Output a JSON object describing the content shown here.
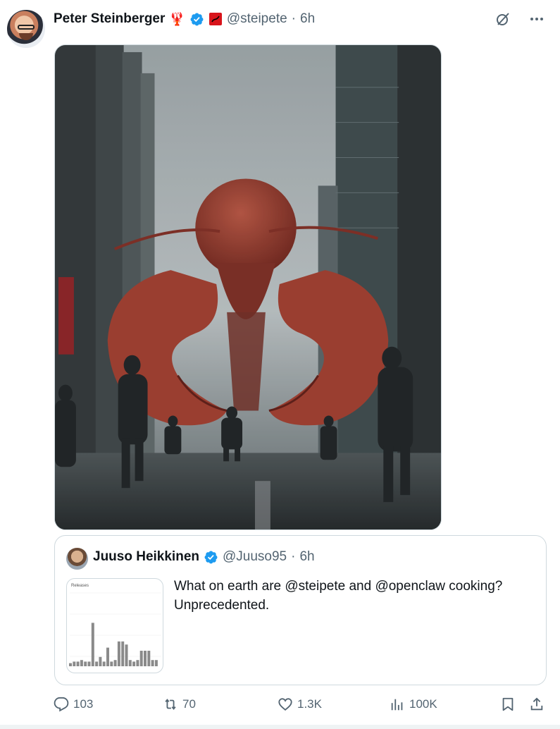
{
  "tweet": {
    "author_name": "Peter Steinberger",
    "author_emoji": "🦞",
    "author_handle": "@steipete",
    "separator": "·",
    "time": "6h",
    "image_icon": "lobster-in-city-image"
  },
  "quoted": {
    "author_name": "Juuso Heikkinen",
    "author_handle": "@Juuso95",
    "separator": "·",
    "time": "6h",
    "text": "What on earth are @steipete and @openclaw cooking?\nUnprecedented.",
    "thumbnail_label": "Releases",
    "thumbnail_bars": [
      2,
      3,
      3,
      4,
      3,
      3,
      28,
      3,
      6,
      3,
      12,
      3,
      4,
      16,
      16,
      14,
      4,
      3,
      4,
      10,
      10,
      10,
      4,
      4
    ]
  },
  "actions": {
    "replies": "103",
    "reposts": "70",
    "likes": "1.3K",
    "views": "100K"
  },
  "colors": {
    "verified": "#1d9bf0",
    "muted": "#536471",
    "text": "#0f1419",
    "border": "#cfd9de"
  }
}
